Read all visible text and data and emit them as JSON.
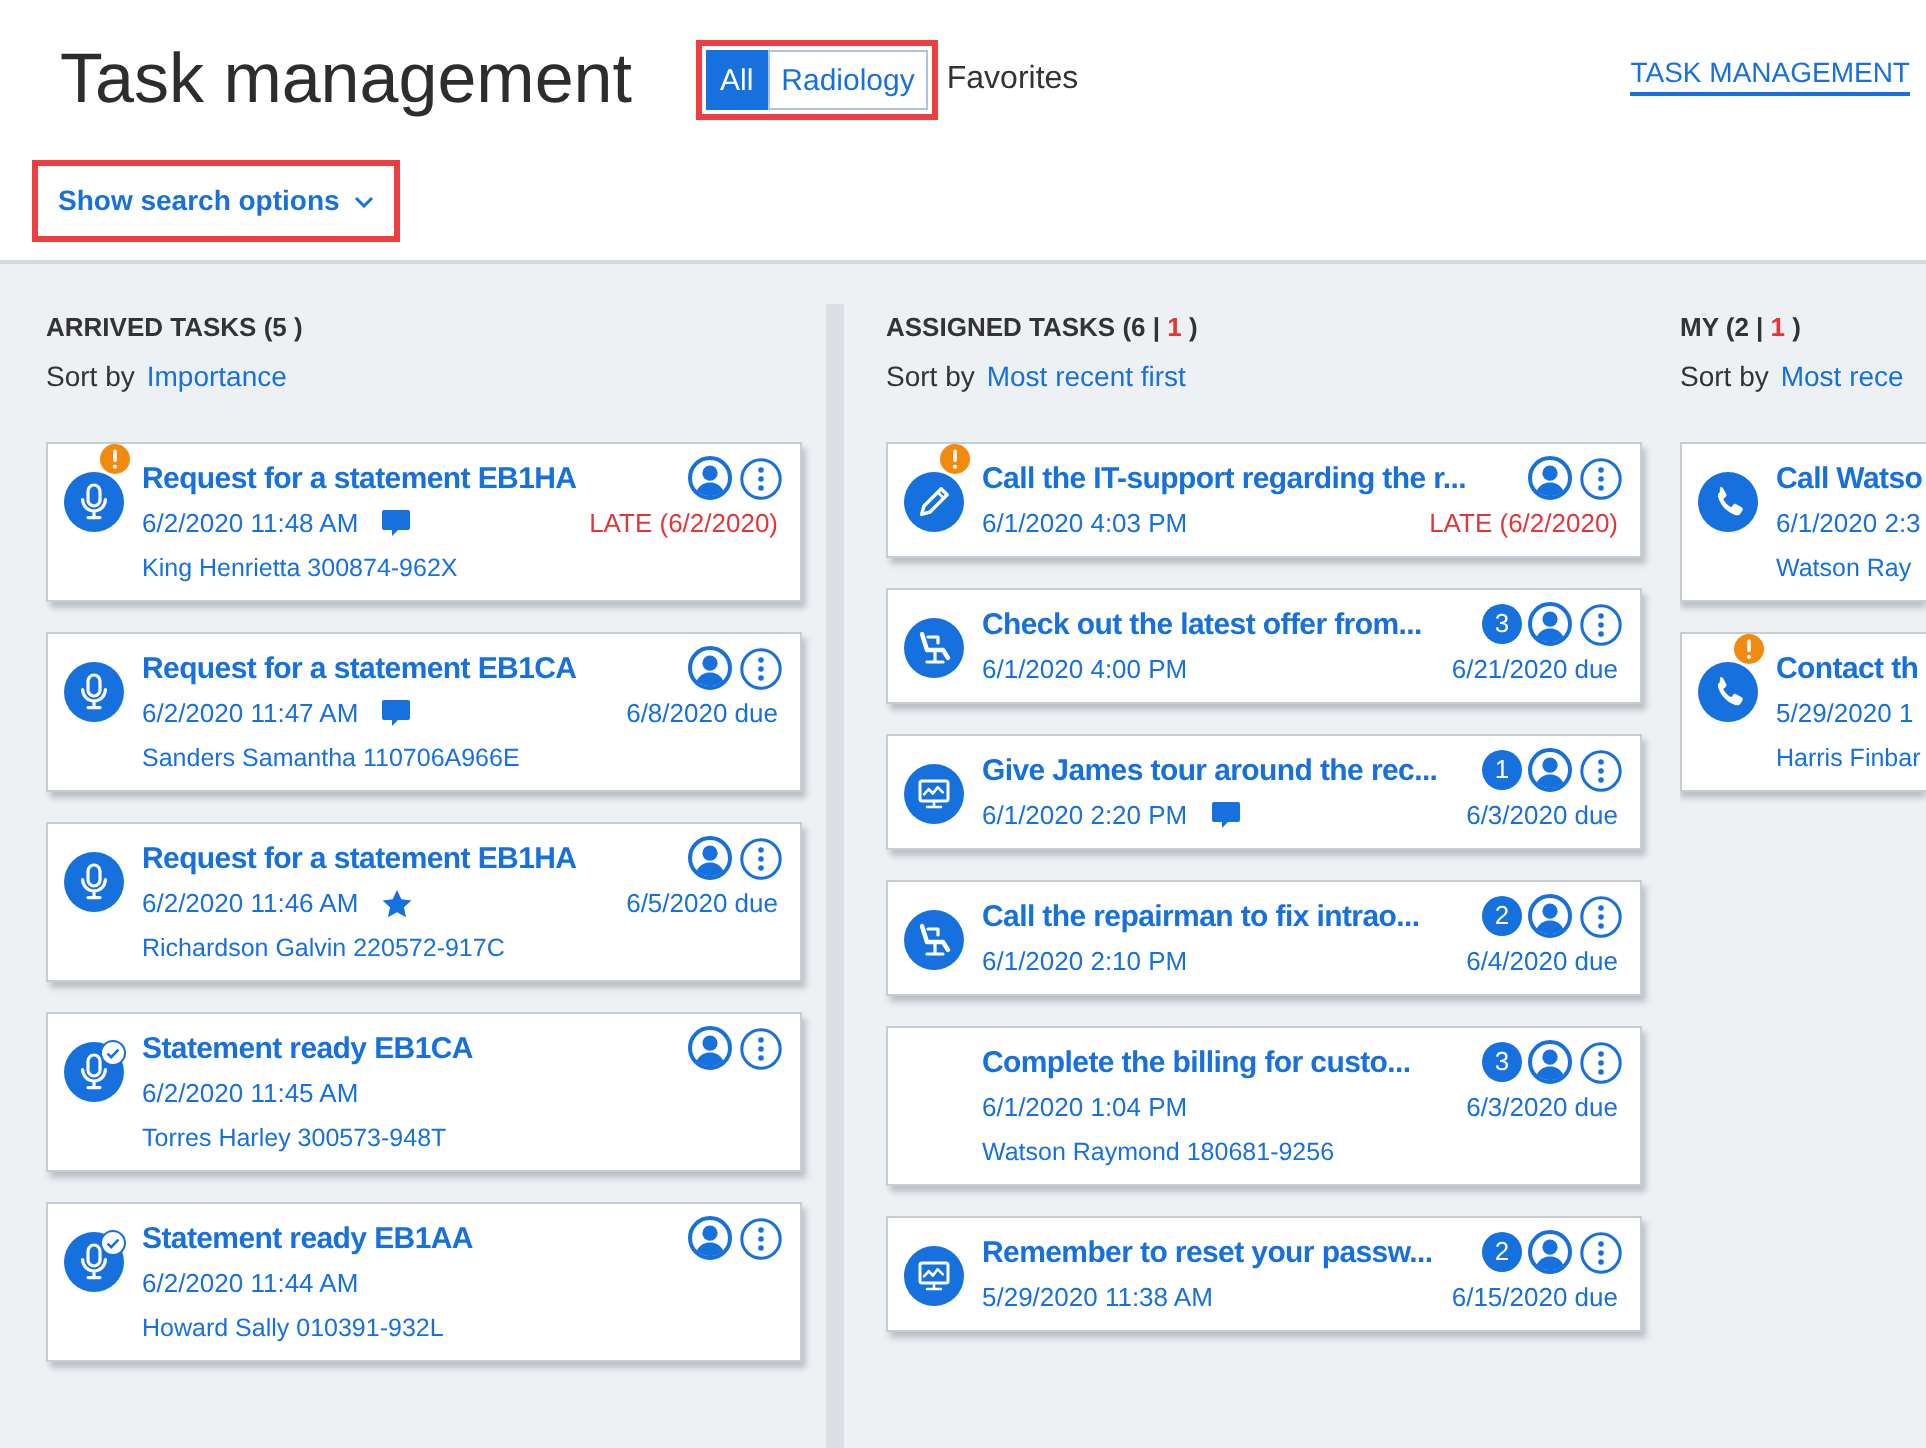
{
  "header": {
    "title": "Task management",
    "filter": {
      "highlighted": true,
      "tabs": [
        {
          "label": "All",
          "selected": true
        },
        {
          "label": "Radiology",
          "selected": false
        }
      ]
    },
    "favorites": "Favorites",
    "nav_link": "TASK MANAGEMENT",
    "search_toggle": {
      "label": "Show search options",
      "highlighted": true
    }
  },
  "columns": [
    {
      "clipped": false,
      "heading": [
        {
          "text": "ARRIVED TASKS (5 )",
          "kind": "plain"
        }
      ],
      "sort_label": "Sort by",
      "sort_value": "Importance",
      "cards": [
        {
          "kind": "microphone",
          "alert": true,
          "done": false,
          "title": "Request for a statement EB1HA",
          "time": "6/2/2020 11:48 AM",
          "has_comment": true,
          "starred": false,
          "due": "LATE (6/2/2020)",
          "late": true,
          "patient": "King Henrietta 300874-962X"
        },
        {
          "kind": "microphone",
          "alert": false,
          "done": false,
          "title": "Request for a statement EB1CA",
          "time": "6/2/2020 11:47 AM",
          "has_comment": true,
          "starred": false,
          "due": "6/8/2020 due",
          "late": false,
          "patient": "Sanders Samantha 110706A966E"
        },
        {
          "kind": "microphone",
          "alert": false,
          "done": false,
          "title": "Request for a statement EB1HA",
          "time": "6/2/2020 11:46 AM",
          "has_comment": false,
          "starred": true,
          "due": "6/5/2020 due",
          "late": false,
          "patient": "Richardson Galvin 220572-917C"
        },
        {
          "kind": "microphone",
          "alert": false,
          "done": true,
          "title": "Statement ready EB1CA",
          "time": "6/2/2020 11:45 AM",
          "has_comment": false,
          "starred": false,
          "patient": "Torres Harley 300573-948T"
        },
        {
          "kind": "microphone",
          "alert": false,
          "done": true,
          "title": "Statement ready EB1AA",
          "time": "6/2/2020 11:44 AM",
          "has_comment": false,
          "starred": false,
          "patient": "Howard Sally 010391-932L"
        }
      ]
    },
    {
      "clipped": false,
      "heading": [
        {
          "text": "ASSIGNED TASKS (6 | ",
          "kind": "plain"
        },
        {
          "text": "1",
          "kind": "late"
        },
        {
          "text": " )",
          "kind": "plain"
        }
      ],
      "sort_label": "Sort by",
      "sort_value": "Most recent first",
      "cards": [
        {
          "kind": "pencil",
          "alert": true,
          "done": false,
          "title": "Call the IT-support regarding the r...",
          "time": "6/1/2020 4:03 PM",
          "has_comment": false,
          "starred": false,
          "due": "LATE (6/2/2020)",
          "late": true
        },
        {
          "kind": "dental-chair",
          "alert": false,
          "done": false,
          "title": "Check out the latest offer from...",
          "count": "3",
          "time": "6/1/2020 4:00 PM",
          "has_comment": false,
          "starred": false,
          "due": "6/21/2020 due",
          "late": false
        },
        {
          "kind": "monitor",
          "alert": false,
          "done": false,
          "title": "Give James tour around the rec...",
          "count": "1",
          "time": "6/1/2020 2:20 PM",
          "has_comment": true,
          "starred": false,
          "due": "6/3/2020 due",
          "late": false
        },
        {
          "kind": "dental-chair",
          "alert": false,
          "done": false,
          "title": "Call the repairman to fix intrao...",
          "count": "2",
          "time": "6/1/2020 2:10 PM",
          "has_comment": false,
          "starred": false,
          "due": "6/4/2020 due",
          "late": false
        },
        {
          "alert": false,
          "done": false,
          "title": "Complete the billing for custo...",
          "count": "3",
          "time": "6/1/2020 1:04 PM",
          "has_comment": false,
          "starred": false,
          "due": "6/3/2020 due",
          "late": false,
          "patient": "Watson Raymond 180681-9256"
        },
        {
          "kind": "monitor",
          "alert": false,
          "done": false,
          "title": "Remember to reset your passw...",
          "count": "2",
          "time": "5/29/2020 11:38 AM",
          "has_comment": false,
          "starred": false,
          "due": "6/15/2020 due",
          "late": false
        }
      ]
    },
    {
      "clipped": true,
      "heading": [
        {
          "text": "MY (2 | ",
          "kind": "plain"
        },
        {
          "text": "1",
          "kind": "late"
        },
        {
          "text": " )",
          "kind": "plain"
        }
      ],
      "sort_label": "Sort by",
      "sort_value": "Most rece",
      "cards": [
        {
          "kind": "phone",
          "alert": false,
          "done": false,
          "title": "Call Watso",
          "time": "6/1/2020 2:3",
          "patient": "Watson Ray"
        },
        {
          "kind": "phone",
          "alert": true,
          "done": false,
          "title": "Contact th",
          "time": "5/29/2020 1",
          "patient": "Harris Finbar"
        }
      ]
    }
  ]
}
